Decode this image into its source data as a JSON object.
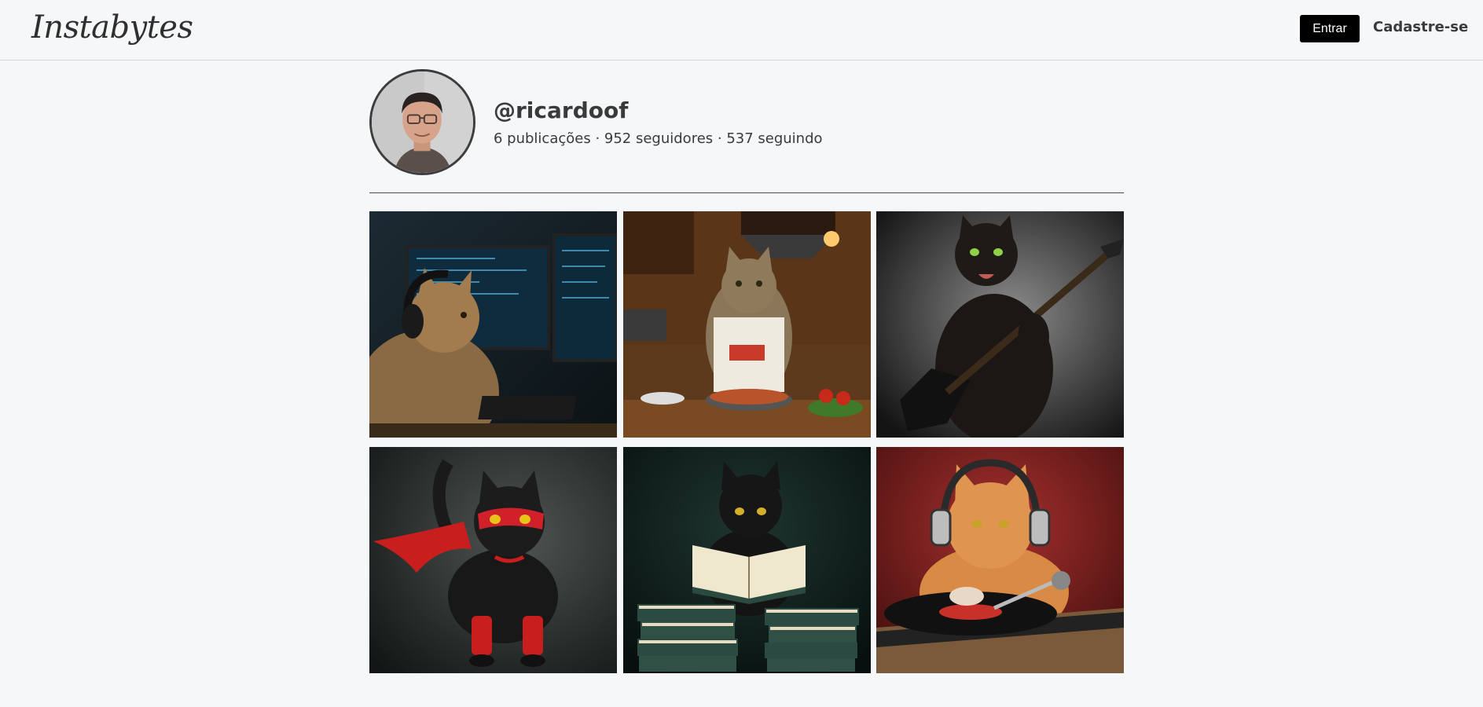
{
  "header": {
    "logo_text": "Instabytes",
    "login_label": "Entrar",
    "signup_label": "Cadastre-se"
  },
  "profile": {
    "username": "@ricardoof",
    "stats": "6 publicações · 952 seguidores · 537 seguindo"
  },
  "posts": [
    {
      "subject": "cat-programmer"
    },
    {
      "subject": "cat-chef"
    },
    {
      "subject": "cat-guitarist"
    },
    {
      "subject": "cat-superhero"
    },
    {
      "subject": "cat-reader"
    },
    {
      "subject": "cat-dj"
    }
  ],
  "colors": {
    "background": "#f6f7f9",
    "login_button": "#000000",
    "text": "#3a3a3a"
  }
}
